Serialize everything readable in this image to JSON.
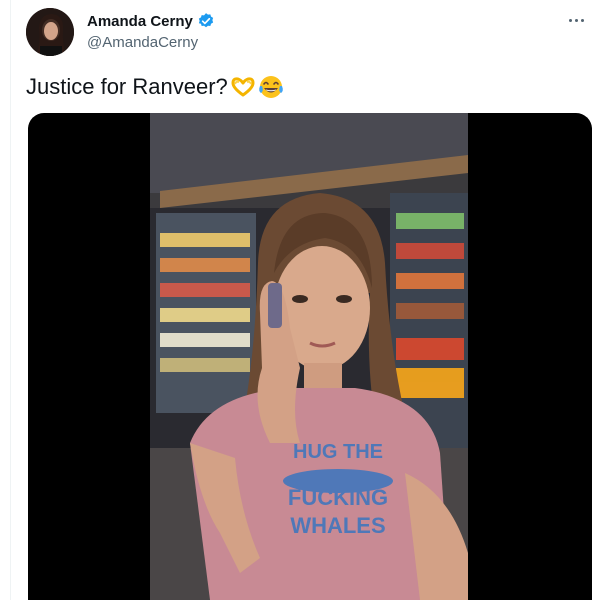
{
  "author": {
    "display_name": "Amanda Cerny",
    "handle": "@AmandaCerny",
    "verified": true,
    "avatar_icon": "profile-photo"
  },
  "tweet": {
    "text": "Justice for Ranveer?",
    "emojis": [
      "heart-hands-emoji",
      "tears-of-joy-emoji"
    ]
  },
  "media": {
    "type": "video",
    "shirt_text": [
      "HUG THE",
      "FUCKING",
      "WHALES"
    ]
  },
  "colors": {
    "verified_badge": "#1d9bf0",
    "text_primary": "#0f1419",
    "text_secondary": "#536471"
  }
}
